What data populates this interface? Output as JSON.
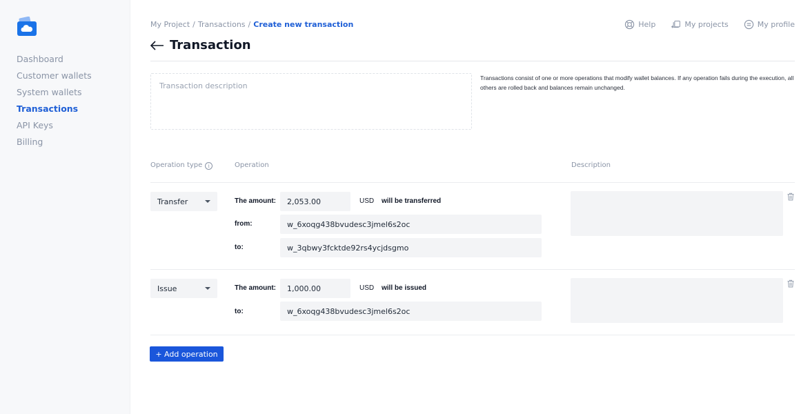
{
  "sidebar": {
    "items": [
      {
        "label": "Dashboard"
      },
      {
        "label": "Customer wallets"
      },
      {
        "label": "System wallets"
      },
      {
        "label": "Transactions"
      },
      {
        "label": "API Keys"
      },
      {
        "label": "Billing"
      }
    ],
    "active": "Transactions"
  },
  "breadcrumb": {
    "items": [
      "My Project",
      "Transactions",
      "Create new transaction"
    ],
    "separator": "/"
  },
  "topnav": {
    "help": "Help",
    "projects": "My projects",
    "profile": "My profile"
  },
  "page": {
    "title": "Transaction",
    "description_placeholder": "Transaction description",
    "help_text": "Transactions consist of one or more operations that modify wallet balances. If any operation fails during the execution, all others are rolled back and balances remain unchanged."
  },
  "columns": {
    "type": "Operation type",
    "operation": "Operation",
    "description": "Description"
  },
  "operations": [
    {
      "type": "Transfer",
      "amount_label": "The amount:",
      "amount": "2,053.00",
      "currency": "USD",
      "suffix": "will be transferred",
      "from_label": "from:",
      "from": "w_6xoqg438bvudesc3jmel6s2oc",
      "to_label": "to:",
      "to": "w_3qbwy3fcktde92rs4ycjdsgmo"
    },
    {
      "type": "Issue",
      "amount_label": "The amount:",
      "amount": "1,000.00",
      "currency": "USD",
      "suffix": "will be issued",
      "to_label": "to:",
      "to": "w_6xoqg438bvudesc3jmel6s2oc"
    }
  ],
  "actions": {
    "add_operation": "+ Add operation"
  },
  "colors": {
    "accent": "#1a56db",
    "active_nav": "#1f5fd6",
    "sidebar_bg": "#f7f8fa",
    "field_bg": "#f3f4f6"
  }
}
